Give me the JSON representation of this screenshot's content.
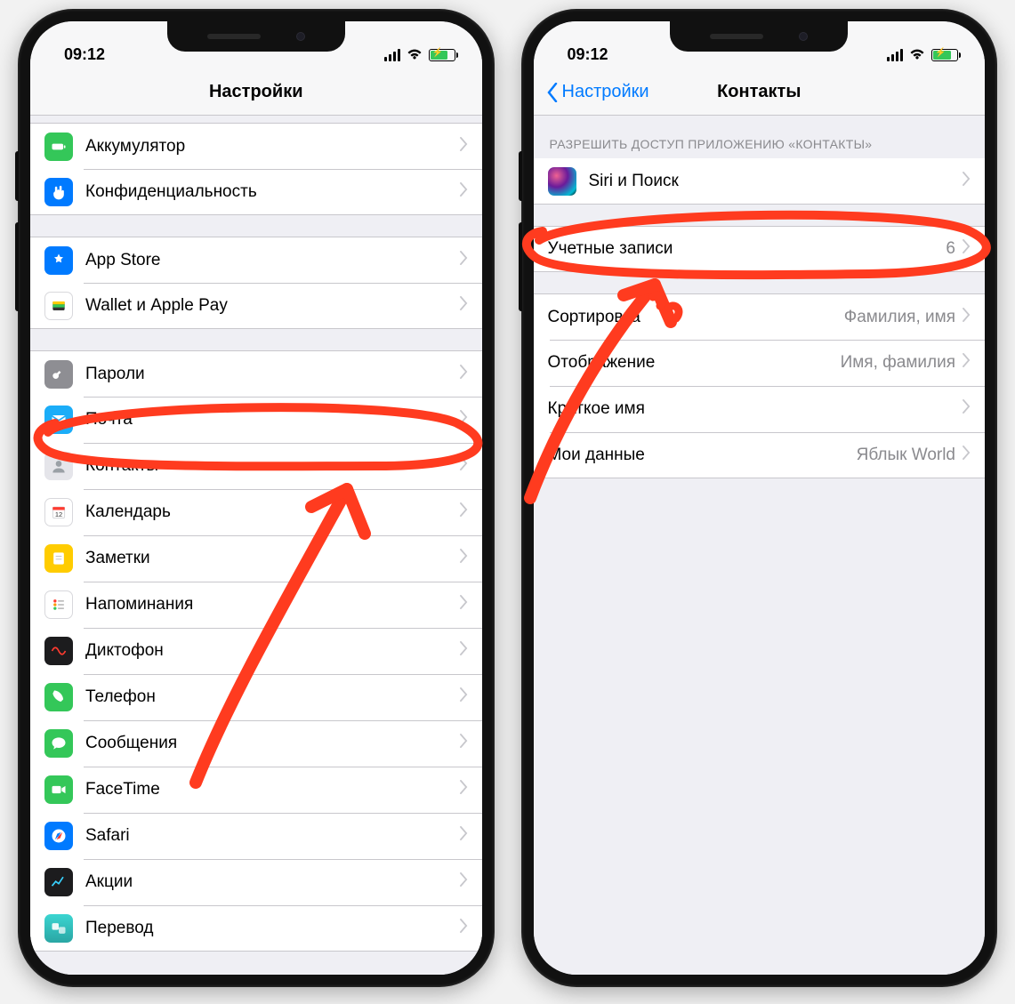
{
  "left": {
    "statusTime": "09:12",
    "navTitle": "Настройки",
    "g1": [
      {
        "id": "battery",
        "label": "Аккумулятор"
      },
      {
        "id": "privacy",
        "label": "Конфиденциальность"
      }
    ],
    "g2": [
      {
        "id": "appstore",
        "label": "App Store"
      },
      {
        "id": "wallet",
        "label": "Wallet и Apple Pay"
      }
    ],
    "g3": [
      {
        "id": "passwords",
        "label": "Пароли"
      },
      {
        "id": "mail",
        "label": "Почта"
      },
      {
        "id": "contacts",
        "label": "Контакты"
      },
      {
        "id": "calendar",
        "label": "Календарь"
      },
      {
        "id": "notes",
        "label": "Заметки"
      },
      {
        "id": "reminders",
        "label": "Напоминания"
      },
      {
        "id": "voicememo",
        "label": "Диктофон"
      },
      {
        "id": "phone",
        "label": "Телефон"
      },
      {
        "id": "messages",
        "label": "Сообщения"
      },
      {
        "id": "facetime",
        "label": "FaceTime"
      },
      {
        "id": "safari",
        "label": "Safari"
      },
      {
        "id": "stocks",
        "label": "Акции"
      },
      {
        "id": "translate",
        "label": "Перевод"
      }
    ]
  },
  "right": {
    "statusTime": "09:12",
    "navBack": "Настройки",
    "navTitle": "Контакты",
    "sectionHeader": "РАЗРЕШИТЬ ДОСТУП ПРИЛОЖЕНИЮ «КОНТАКТЫ»",
    "siri": {
      "label": "Siri и Поиск"
    },
    "accounts": {
      "label": "Учетные записи",
      "value": "6"
    },
    "rows": [
      {
        "id": "sort",
        "label": "Сортировка",
        "value": "Фамилия, имя"
      },
      {
        "id": "display",
        "label": "Отображение",
        "value": "Имя, фамилия"
      },
      {
        "id": "shortname",
        "label": "Краткое имя",
        "value": ""
      },
      {
        "id": "mydata",
        "label": "Мои данные",
        "value": "Яблык World"
      }
    ]
  }
}
